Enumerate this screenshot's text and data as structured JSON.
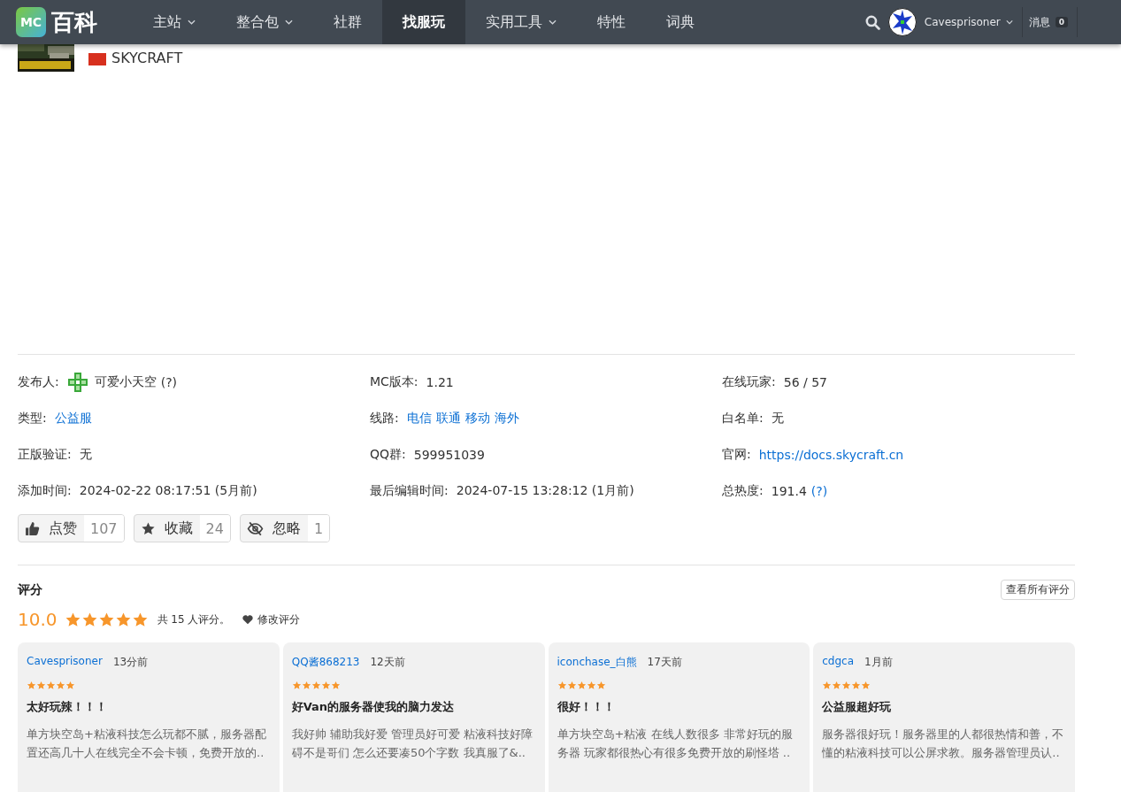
{
  "nav": {
    "logo_badge": "MC",
    "logo_text": "百科",
    "items": [
      {
        "label": "主站",
        "dropdown": true,
        "selected": false
      },
      {
        "label": "整合包",
        "dropdown": true,
        "selected": false
      },
      {
        "label": "社群",
        "dropdown": false,
        "selected": false
      },
      {
        "label": "找服玩",
        "dropdown": false,
        "selected": true
      },
      {
        "label": "实用工具",
        "dropdown": true,
        "selected": false
      },
      {
        "label": "特性",
        "dropdown": false,
        "selected": false
      },
      {
        "label": "词典",
        "dropdown": false,
        "selected": false
      }
    ],
    "user": {
      "name": "Cavesprisoner"
    },
    "messages": {
      "label": "消息",
      "count": "0"
    }
  },
  "server": {
    "title": "SKYCRAFT"
  },
  "info": [
    {
      "label": "发布人:",
      "kind": "user",
      "parts": [
        {
          "text": "可爱小天空",
          "link": false
        },
        {
          "text": "(?)",
          "link": false
        }
      ]
    },
    {
      "label": "MC版本:",
      "kind": "plain",
      "parts": [
        {
          "text": "1.21",
          "link": false
        }
      ]
    },
    {
      "label": "在线玩家:",
      "kind": "plain",
      "parts": [
        {
          "text": "56 / 57",
          "link": false
        }
      ]
    },
    {
      "label": "类型:",
      "kind": "plain",
      "parts": [
        {
          "text": "公益服",
          "link": true
        }
      ]
    },
    {
      "label": "线路:",
      "kind": "plain",
      "parts": [
        {
          "text": "电信",
          "link": true
        },
        {
          "text": "联通",
          "link": true
        },
        {
          "text": "移动",
          "link": true
        },
        {
          "text": "海外",
          "link": true
        }
      ]
    },
    {
      "label": "白名单:",
      "kind": "plain",
      "parts": [
        {
          "text": "无",
          "link": false
        }
      ]
    },
    {
      "label": "正版验证:",
      "kind": "plain",
      "parts": [
        {
          "text": "无",
          "link": false
        }
      ]
    },
    {
      "label": "QQ群:",
      "kind": "plain",
      "parts": [
        {
          "text": "599951039",
          "link": false
        }
      ]
    },
    {
      "label": "官网:",
      "kind": "plain",
      "parts": [
        {
          "text": "https://docs.skycraft.cn",
          "link": true
        }
      ]
    },
    {
      "label": "添加时间:",
      "kind": "plain",
      "parts": [
        {
          "text": "2024-02-22 08:17:51 (5月前)",
          "link": false
        }
      ]
    },
    {
      "label": "最后编辑时间:",
      "kind": "plain",
      "parts": [
        {
          "text": "2024-07-15 13:28:12 (1月前)",
          "link": false
        }
      ]
    },
    {
      "label": "总热度:",
      "kind": "plain",
      "parts": [
        {
          "text": "191.4",
          "link": false
        },
        {
          "text": "(?)",
          "link": true
        }
      ]
    }
  ],
  "actions": [
    {
      "kind": "thumb",
      "label": "点赞",
      "count": "107"
    },
    {
      "kind": "star",
      "label": "收藏",
      "count": "24"
    },
    {
      "kind": "eye-slash",
      "label": "忽略",
      "count": "1"
    }
  ],
  "rating": {
    "title": "评分",
    "view_all": "查看所有评分",
    "score": "10.0",
    "stars": 5,
    "summary": "共 15 人评分。",
    "edit": "修改评分"
  },
  "reviews": [
    {
      "user": "Cavesprisoner",
      "time": "13分前",
      "stars": 5,
      "title": "太好玩辣！！！",
      "body": "单方块空岛+粘液科技怎么玩都不腻，服务器配置还高几十人在线完全不会卡顿，免费开放的.."
    },
    {
      "user": "QQ酱868213",
      "time": "12天前",
      "stars": 5,
      "title": "好Van的服务器使我的脑力发达",
      "body": "我好帅 辅助我好爱 管理员好可爱 粘液科技好障碍不是哥们 怎么还要凑50个字数 我真服了&.."
    },
    {
      "user": "iconchase_白熊",
      "time": "17天前",
      "stars": 5,
      "title": "很好！！！",
      "body": "单方块空岛+粘液 在线人数很多 非常好玩的服务器 玩家都很热心有很多免费开放的刷怪塔 .."
    },
    {
      "user": "cdgca",
      "time": "1月前",
      "stars": 5,
      "title": "公益服超好玩",
      "body": "服务器很好玩！服务器里的人都很热情和善，不懂的粘液科技可以公屏求教。服务器管理员认.."
    }
  ]
}
